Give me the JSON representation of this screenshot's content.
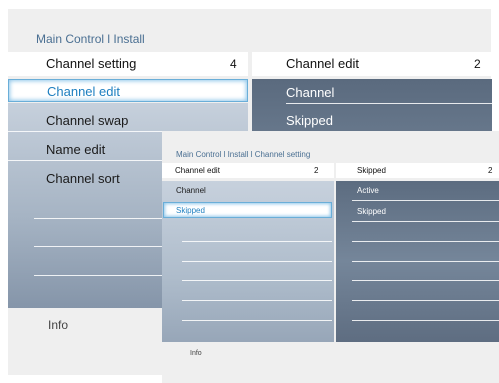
{
  "outer": {
    "breadcrumb": "Main Control l Install",
    "left_header": {
      "label": "Channel setting",
      "count": "4"
    },
    "right_header": {
      "label": "Channel edit",
      "count": "2"
    },
    "left_items": [
      "Channel edit",
      "Channel swap",
      "Name edit",
      "Channel sort"
    ],
    "right_items": [
      "Channel",
      "Skipped"
    ],
    "info": "Info"
  },
  "inner": {
    "breadcrumb": "Main Control l Install l Channel setting",
    "left_header": {
      "label": "Channel edit",
      "count": "2"
    },
    "right_header": {
      "label": "Skipped",
      "count": "2"
    },
    "left_items": [
      "Channel",
      "Skipped"
    ],
    "right_items": [
      "Active",
      "Skipped"
    ],
    "info": "Info"
  },
  "colors": {
    "accent": "#1e7fc0",
    "panel_dark": "#5d6c80",
    "panel_light": "#c6d0dc"
  }
}
